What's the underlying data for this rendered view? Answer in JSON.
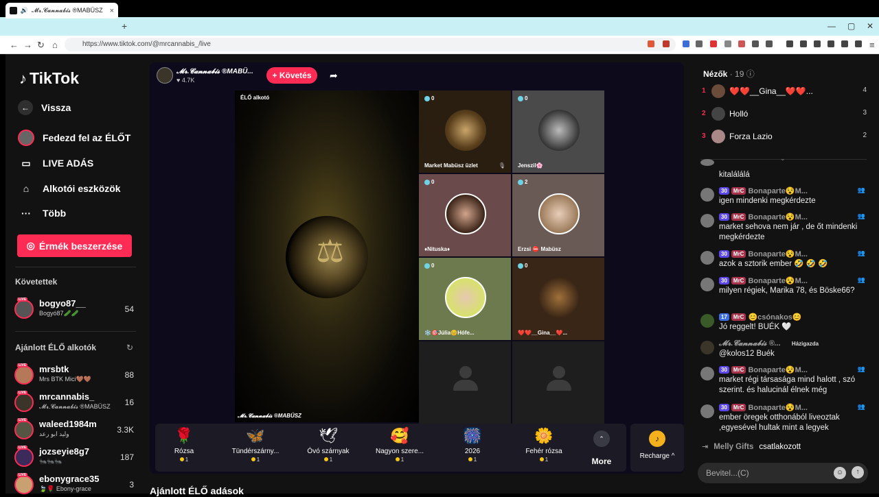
{
  "browser": {
    "tab_title": "𝓜𝓻.𝓒𝓪𝓷𝓷𝓪𝓫𝓲𝓼 ®MABÜSZ",
    "url": "https://www.tiktok.com/@mrcannabis_/live",
    "tab_close": "×",
    "new_tab": "+"
  },
  "sidebar": {
    "logo": "TikTok",
    "back": "Vissza",
    "nav": [
      "Fedezd fel az ÉLŐT",
      "LIVE ADÁS",
      "Alkotói eszközök",
      "Több"
    ],
    "coin_button": "Érmék beszerzése",
    "following_header": "Követettek",
    "following": [
      {
        "name": "bogyo87__",
        "sub": "Bogyó87🥒🥒",
        "count": "54"
      }
    ],
    "suggested_header": "Ajánlott ÉLŐ alkotók",
    "suggested": [
      {
        "name": "mrsbtk",
        "sub": "Mrs BTK Mici🤎🤎",
        "count": "88"
      },
      {
        "name": "mrcannabis_",
        "sub": "𝓜𝓻.𝓒𝓪𝓷𝓷𝓪𝓫𝓲𝓼 ®MABÜSZ",
        "count": "16"
      },
      {
        "name": "waleed1984m",
        "sub": "وليد ابو رعد",
        "count": "3.3K"
      },
      {
        "name": "jozseyie8g7",
        "sub": "🐜🐜🐜",
        "count": "187"
      },
      {
        "name": "ebonygrace35",
        "sub": "🍃🌹 Ebony-grace",
        "count": "3"
      }
    ],
    "live_tag": "LIVE"
  },
  "stream": {
    "host_name": "𝓜𝓻.𝓒𝓪𝓷𝓷𝓪𝓫𝓲𝓼 ®MABÜ...",
    "host_likes": "♥ 4.7K",
    "follow_label": "+ Követés",
    "main_label": "ÉLŐ alkotó",
    "main_footer": "𝓜𝓻.𝓒𝓪𝓷𝓷𝓪𝓫𝓲𝓼 ®MABÜSZ",
    "guests": [
      {
        "count": "0",
        "name": "Market Mabüsz üzlet"
      },
      {
        "count": "0",
        "name": "Jenszil🌸"
      },
      {
        "count": "0",
        "name": "♦Nituska♦"
      },
      {
        "count": "2",
        "name": "Erzsi ⛔ Mabüsz"
      },
      {
        "count": "0",
        "name": "❄️🎯Júlia😊Hófe..."
      },
      {
        "count": "0",
        "name": "❤️❤️__Gina__❤️..."
      }
    ]
  },
  "gifts": {
    "items": [
      {
        "icon": "🌹",
        "name": "Rózsa",
        "price": "1"
      },
      {
        "icon": "🦋",
        "name": "Tündérszárny...",
        "price": "1"
      },
      {
        "icon": "🕊",
        "name": "Óvó szárnyak",
        "price": "1"
      },
      {
        "icon": "🥰",
        "name": "Nagyon szere...",
        "price": "1"
      },
      {
        "icon": "🎆",
        "name": "2026",
        "price": "1"
      },
      {
        "icon": "🌼",
        "name": "Fehér rózsa",
        "price": "1"
      }
    ],
    "more": "More",
    "recharge": "Recharge ^"
  },
  "bottom_title": "Ajánlott ÉLŐ adások",
  "viewers": {
    "title": "Nézők",
    "count": "· 19",
    "list": [
      {
        "rank": "1",
        "name": "❤️❤️__Gina__❤️❤️...",
        "score": "4"
      },
      {
        "rank": "2",
        "name": "Holló",
        "score": "3"
      },
      {
        "rank": "3",
        "name": "Forza Lazio",
        "score": "2"
      }
    ]
  },
  "chat": {
    "partial_msg": "kitalálálá",
    "messages": [
      {
        "lvl": "30",
        "fan": "MrC",
        "user": "Bonaparte😵M...",
        "text": "igen mindenki megkérdezte"
      },
      {
        "lvl": "30",
        "fan": "MrC",
        "user": "Bonaparte😵M...",
        "text": "market sehova nem jár , de őt mindenki megkérdezte"
      },
      {
        "lvl": "30",
        "fan": "MrC",
        "user": "Bonaparte😵M...",
        "text": "azok a sztorik ember 🤣 🤣 🤣"
      },
      {
        "lvl": "30",
        "fan": "MrC",
        "user": "Bonaparte😵M...",
        "text": "milyen régiek, Marika 78, és Böske66?"
      },
      {
        "lvl": "17",
        "fan": "MrC",
        "user": "😊csónakos😊",
        "text": "Jó reggelt! BUÉK 🤍"
      },
      {
        "lvl": "",
        "fan": "",
        "user": "𝓜𝓻.𝓒𝓪𝓷𝓷𝓪𝓫𝓲𝓼 ®...",
        "host": "Házigazda",
        "text": "@kolos12 Buék"
      },
      {
        "lvl": "30",
        "fan": "MrC",
        "user": "Bonaparte😵M...",
        "text": "market régi társasága mind halott , szó szerint. és halucinál élnek még"
      },
      {
        "lvl": "30",
        "fan": "MrC",
        "user": "Bonaparte😵M...",
        "text": "ember öregek otthonából liveoztak ,egyesével hultak mint a legyek"
      }
    ],
    "join_user": "Melly Gifts",
    "join_text": "csatlakozott",
    "input_placeholder": "Bevitel...(C)"
  }
}
